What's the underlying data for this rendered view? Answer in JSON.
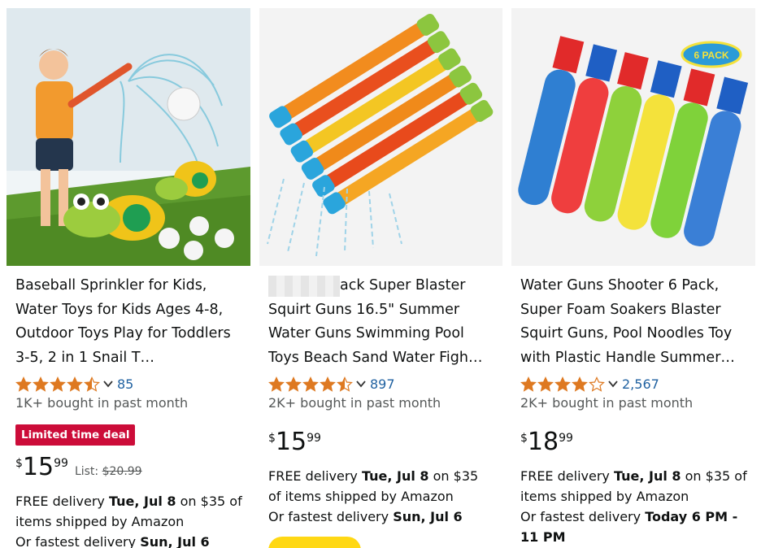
{
  "products": [
    {
      "title": "Baseball Sprinkler for Kids, Water Toys for Kids Ages 4-8, Outdoor Toys Play for Toddlers 3-5, 2 in 1 Snail T…",
      "rating": 4.5,
      "review_count": "85",
      "bought": "1K+ bought in past month",
      "deal_badge": "Limited time deal",
      "price_symbol": "$",
      "price_whole": "15",
      "price_fraction": "99",
      "list_label": "List:",
      "list_price": "$20.99",
      "delivery_pre": "FREE delivery ",
      "delivery_date": "Tue, Jul 8",
      "delivery_post": " on $35 of items shipped by Amazon",
      "fastest_pre": "Or fastest delivery ",
      "fastest_date": "Sun, Jul 6"
    },
    {
      "title": "ack Super Blaster Squirt Guns 16.5\" Summer Water Guns Swimming Pool Toys Beach Sand Water Figh…",
      "rating": 4.5,
      "review_count": "897",
      "bought": "2K+ bought in past month",
      "price_symbol": "$",
      "price_whole": "15",
      "price_fraction": "99",
      "delivery_pre": "FREE delivery ",
      "delivery_date": "Tue, Jul 8",
      "delivery_post": " on $35 of items shipped by Amazon",
      "fastest_pre": "Or fastest delivery ",
      "fastest_date": "Sun, Jul 6"
    },
    {
      "title": "Water Guns Shooter 6 Pack, Super Foam Soakers Blaster Squirt Guns, Pool Noodles Toy with Plastic Handle Summer…",
      "rating": 4.0,
      "review_count": "2,567",
      "bought": "2K+ bought in past month",
      "image_badge": "6 PACK",
      "price_symbol": "$",
      "price_whole": "18",
      "price_fraction": "99",
      "delivery_pre": "FREE delivery ",
      "delivery_date": "Tue, Jul 8",
      "delivery_post": " on $35 of items shipped by Amazon",
      "fastest_pre": "Or fastest delivery ",
      "fastest_date": "Today 6 PM - 11 PM"
    }
  ],
  "colors": {
    "star": "#de7921",
    "link": "#2162a1",
    "deal": "#cc0c39",
    "cart": "#ffd814"
  },
  "icons": [
    "star-full-icon",
    "star-half-icon",
    "star-empty-icon",
    "chevron-down-icon"
  ]
}
